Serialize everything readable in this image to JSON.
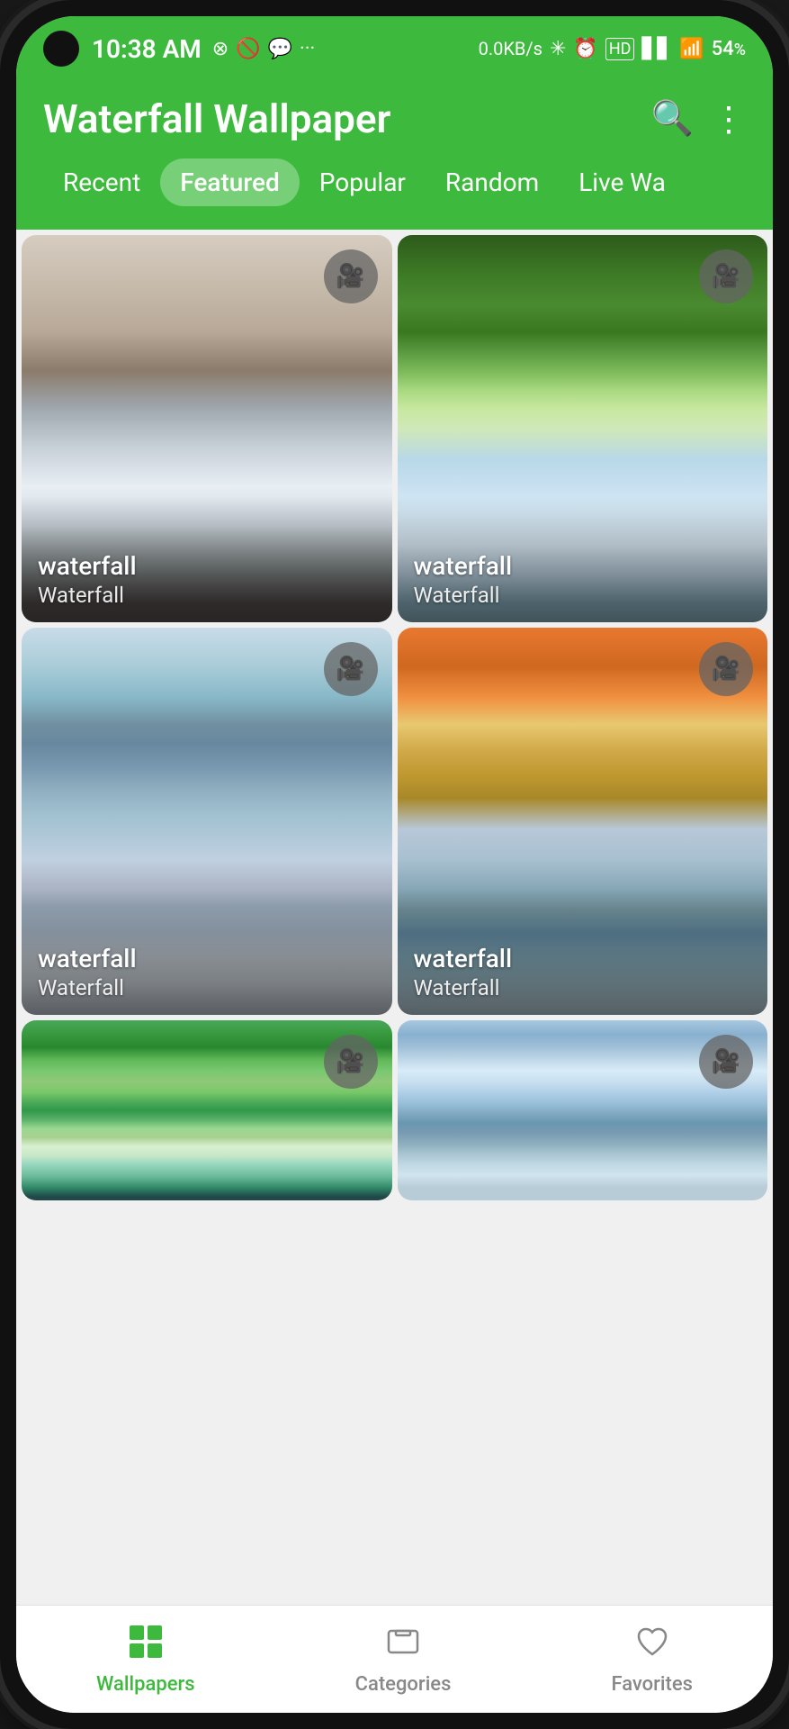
{
  "statusBar": {
    "time": "10:38 AM",
    "networkSpeed": "0.0KB/s",
    "battery": "54"
  },
  "header": {
    "title": "Waterfall Wallpaper",
    "searchLabel": "Search",
    "menuLabel": "More options"
  },
  "tabs": [
    {
      "id": "recent",
      "label": "Recent",
      "active": false
    },
    {
      "id": "featured",
      "label": "Featured",
      "active": true
    },
    {
      "id": "popular",
      "label": "Popular",
      "active": false
    },
    {
      "id": "random",
      "label": "Random",
      "active": false
    },
    {
      "id": "live",
      "label": "Live Wa",
      "active": false
    }
  ],
  "wallpapers": [
    {
      "id": 1,
      "title": "waterfall",
      "subtitle": "Waterfall",
      "hasVideo": true,
      "style": "wf1"
    },
    {
      "id": 2,
      "title": "waterfall",
      "subtitle": "Waterfall",
      "hasVideo": true,
      "style": "wf2"
    },
    {
      "id": 3,
      "title": "waterfall",
      "subtitle": "Waterfall",
      "hasVideo": true,
      "style": "wf3"
    },
    {
      "id": 4,
      "title": "waterfall",
      "subtitle": "Waterfall",
      "hasVideo": true,
      "style": "wf4"
    },
    {
      "id": 5,
      "title": "",
      "subtitle": "",
      "hasVideo": true,
      "style": "wf5",
      "partial": true
    },
    {
      "id": 6,
      "title": "",
      "subtitle": "",
      "hasVideo": true,
      "style": "wf6",
      "partial": true
    }
  ],
  "bottomNav": {
    "items": [
      {
        "id": "wallpapers",
        "label": "Wallpapers",
        "active": true,
        "iconType": "grid"
      },
      {
        "id": "categories",
        "label": "Categories",
        "active": false,
        "iconType": "tablet"
      },
      {
        "id": "favorites",
        "label": "Favorites",
        "active": false,
        "iconType": "heart"
      }
    ]
  },
  "colors": {
    "primary": "#3dba3d",
    "activeTab": "rgba(255,255,255,0.3)"
  }
}
